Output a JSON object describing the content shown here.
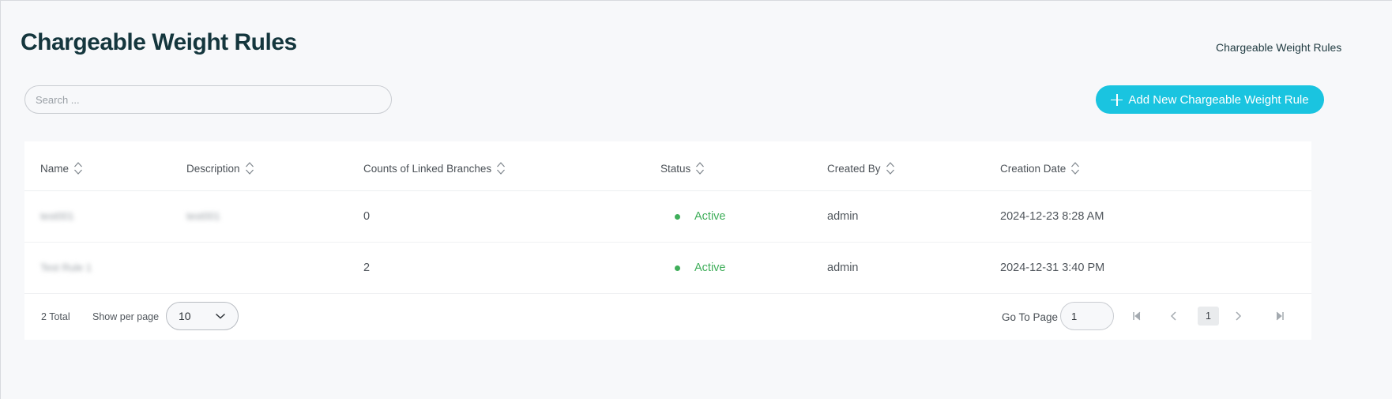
{
  "header": {
    "title": "Chargeable Weight Rules",
    "breadcrumb": "Chargeable Weight Rules"
  },
  "search": {
    "placeholder": "Search ...",
    "value": ""
  },
  "actions": {
    "add_label": "Add New Chargeable Weight Rule"
  },
  "table": {
    "columns": [
      {
        "label": "Name"
      },
      {
        "label": "Description"
      },
      {
        "label": "Counts of Linked Branches"
      },
      {
        "label": "Status"
      },
      {
        "label": "Created By"
      },
      {
        "label": "Creation Date"
      }
    ],
    "rows": [
      {
        "name": "test001",
        "description": "test001",
        "linked_branches": "0",
        "status": "Active",
        "created_by": "admin",
        "creation_date": "2024-12-23 8:28 AM"
      },
      {
        "name": "Test Rule 1",
        "description": "",
        "linked_branches": "2",
        "status": "Active",
        "created_by": "admin",
        "creation_date": "2024-12-31 3:40 PM"
      }
    ]
  },
  "pagination": {
    "total": "2 Total",
    "per_page_label": "Show per page",
    "per_page_value": "10",
    "goto_label": "Go To Page",
    "goto_value": "1",
    "current_page": "1"
  },
  "colors": {
    "accent": "#1ac4e0",
    "status_active": "#3fae5a",
    "title": "#14363d"
  }
}
